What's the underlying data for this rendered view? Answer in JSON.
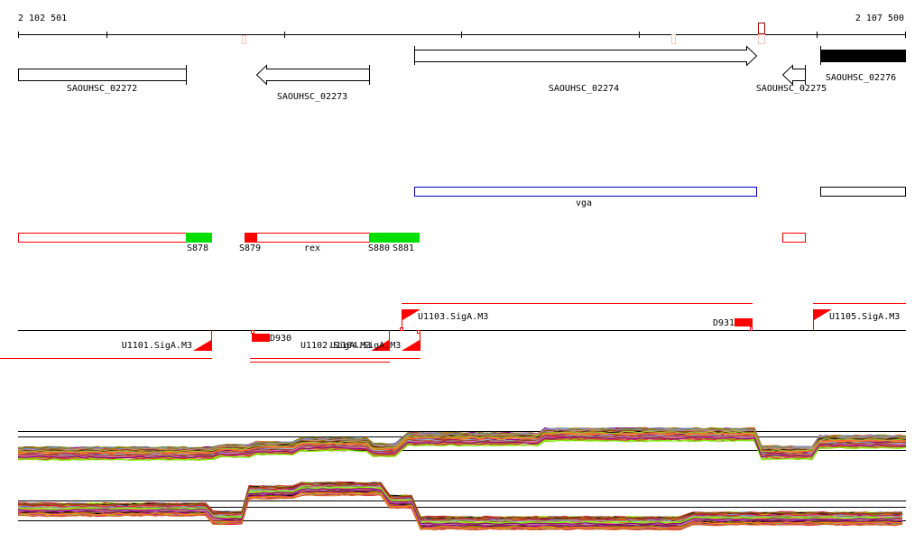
{
  "scale": {
    "start": "2 102 501",
    "end": "2 107 500"
  },
  "genes": [
    {
      "id": "SAOUHSC_02272"
    },
    {
      "id": "SAOUHSC_02273"
    },
    {
      "id": "SAOUHSC_02274"
    },
    {
      "id": "SAOUHSC_02275"
    },
    {
      "id": "SAOUHSC_02276"
    }
  ],
  "annotations": {
    "vga": "vga"
  },
  "features": {
    "s878": "S878",
    "s879": "S879",
    "rex": "rex",
    "s880": "S880",
    "s881": "S881"
  },
  "operons": {
    "u1101": "U1101.SigA.M3",
    "u1102": "U1102.SigA.M3",
    "u1103": "U1103.SigA.M3",
    "u1104": "U1104.SigA.M3",
    "u1105": "U1105.SigA.M3",
    "d930": "D930",
    "d931": "D931"
  },
  "colors": {
    "feature_red": "#ff0000",
    "feature_green": "#00dd00",
    "annotation_blue": "#0000cc",
    "marker_dark": "#990000",
    "marker_pale": "#f4c8b8"
  }
}
